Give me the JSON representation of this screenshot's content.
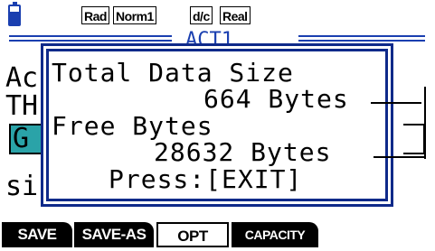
{
  "status_bar": {
    "battery_icon": "battery-icon",
    "badges": [
      "Rad",
      "Norm1",
      "d/c",
      "Real"
    ]
  },
  "background": {
    "title": "ACT1",
    "lines": [
      "Ac",
      "TH",
      "G",
      "si"
    ]
  },
  "dialog": {
    "line1": "Total Data Size",
    "line2": "664 Bytes",
    "line3": "Free Bytes",
    "line4": "28632 Bytes",
    "line5": "Press:[EXIT]"
  },
  "function_keys": [
    "SAVE",
    "SAVE-AS",
    "OPT",
    "CAPACITY"
  ],
  "colors": {
    "accent_blue": "#1a3fb0",
    "border_blue": "#0f2a8a",
    "teal": "#2aa3a8"
  }
}
